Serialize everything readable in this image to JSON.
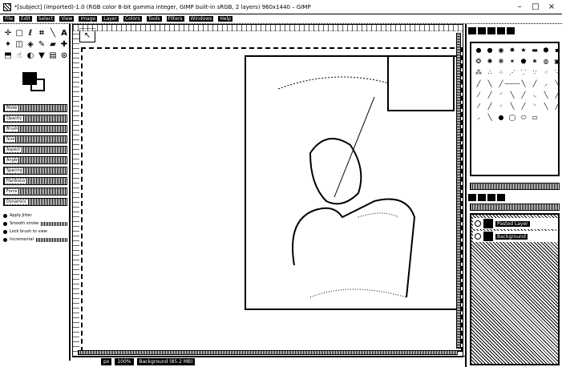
{
  "window": {
    "title": "*[subject] (imported)-1.0 (RGB color 8-bit gamma integer, GIMP built-in sRGB, 2 layers) 960x1440 – GIMP"
  },
  "menu": [
    "File",
    "Edit",
    "Select",
    "View",
    "Image",
    "Layer",
    "Colors",
    "Tools",
    "Filters",
    "Windows",
    "Help"
  ],
  "toolbox": {
    "tools": [
      "move-tool",
      "rect-select-tool",
      "free-select-tool",
      "crop-tool",
      "paths-tool",
      "text-tool",
      "fuzzy-select-tool",
      "unified-transform-tool",
      "warp-transform-tool",
      "paintbrush-tool",
      "eraser-tool",
      "heal-tool",
      "clone-tool",
      "smudge-tool",
      "dodge-tool",
      "bucket-fill-tool",
      "gradient-tool",
      "color-picker-tool"
    ],
    "options": [
      "Mode",
      "Opacity",
      "Brush",
      "Size",
      "Aspect",
      "Angle",
      "Spacing",
      "Hardness",
      "Force",
      "Dynamics"
    ],
    "option_labels": [
      "Apply Jitter",
      "Smooth stroke",
      "Lock brush to view",
      "Incremental"
    ]
  },
  "status": {
    "unit": "px",
    "zoom": "100%",
    "layer_label": "Background (85.2 MB)"
  },
  "layers": {
    "items": [
      "Pasted Layer",
      "Background"
    ]
  }
}
